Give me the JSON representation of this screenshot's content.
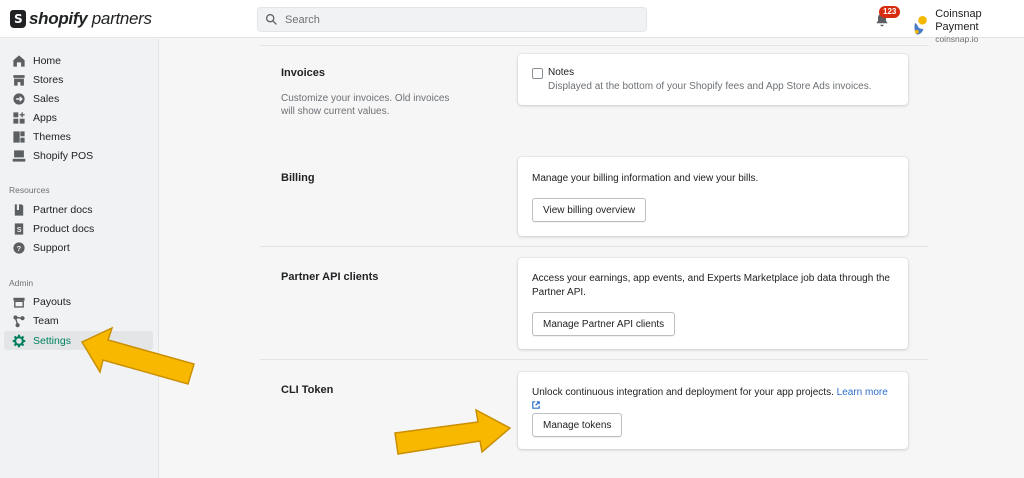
{
  "app": {
    "logo_bold": "shopify",
    "logo_light": " partners"
  },
  "search": {
    "placeholder": "Search"
  },
  "notifications": {
    "count": "123"
  },
  "account": {
    "name": "Coinsnap Payment",
    "domain": "coinsnap.io"
  },
  "sidebar": {
    "main_items": [
      {
        "label": "Home",
        "icon": "home-icon"
      },
      {
        "label": "Stores",
        "icon": "store-icon"
      },
      {
        "label": "Sales",
        "icon": "sales-icon"
      },
      {
        "label": "Apps",
        "icon": "apps-icon"
      },
      {
        "label": "Themes",
        "icon": "themes-icon"
      },
      {
        "label": "Shopify POS",
        "icon": "pos-icon"
      }
    ],
    "resources_title": "Resources",
    "resources_items": [
      {
        "label": "Partner docs",
        "icon": "partner-docs-icon"
      },
      {
        "label": "Product docs",
        "icon": "product-docs-icon"
      },
      {
        "label": "Support",
        "icon": "support-icon"
      }
    ],
    "admin_title": "Admin",
    "admin_items": [
      {
        "label": "Payouts",
        "icon": "payouts-icon"
      },
      {
        "label": "Team",
        "icon": "team-icon"
      },
      {
        "label": "Settings",
        "icon": "gear-icon",
        "active": true
      }
    ]
  },
  "sections": {
    "invoices": {
      "title": "Invoices",
      "description": "Customize your invoices. Old invoices will show current values.",
      "checkbox_label": "Notes",
      "checkbox_help": "Displayed at the bottom of your Shopify fees and App Store Ads invoices.",
      "checked": false
    },
    "billing": {
      "title": "Billing",
      "text": "Manage your billing information and view your bills.",
      "button": "View billing overview"
    },
    "api": {
      "title": "Partner API clients",
      "text": "Access your earnings, app events, and Experts Marketplace job data through the Partner API.",
      "button": "Manage Partner API clients"
    },
    "cli": {
      "title": "CLI Token",
      "text": "Unlock continuous integration and deployment for your app projects.",
      "link": "Learn more",
      "button": "Manage tokens"
    }
  },
  "colors": {
    "accent": "#008060",
    "badge": "#d72c0d",
    "link": "#2c6ecb",
    "arrow": "#f9b800"
  }
}
